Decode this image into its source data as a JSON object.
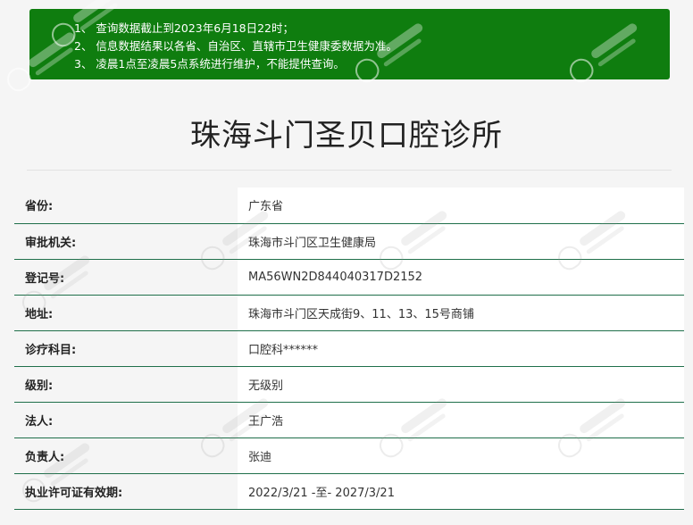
{
  "notice": {
    "lines": [
      "1、 查询数据截止到2023年6月18日22时；",
      "2、 信息数据结果以各省、自治区、直辖市卫生健康委数据为准。",
      "3、 凌晨1点至凌晨5点系统进行维护，不能提供查询。"
    ],
    "background_color": "#0f7d0f"
  },
  "title": "珠海斗门圣贝口腔诊所",
  "rows": [
    {
      "label": "省份:",
      "value": "广东省"
    },
    {
      "label": "审批机关:",
      "value": "珠海市斗门区卫生健康局"
    },
    {
      "label": "登记号:",
      "value": "MA56WN2D844040317D2152"
    },
    {
      "label": "地址:",
      "value": "珠海市斗门区天成街9、11、13、15号商铺"
    },
    {
      "label": "诊疗科目:",
      "value": "口腔科******"
    },
    {
      "label": "级别:",
      "value": "无级别"
    },
    {
      "label": "法人:",
      "value": "王广浩"
    },
    {
      "label": "负责人:",
      "value": "张迪"
    },
    {
      "label": "执业许可证有效期:",
      "value": "2022/3/21 -至- 2027/3/21"
    }
  ],
  "colors": {
    "row_divider": "#1f6f4a",
    "page_background": "#f5f5f5"
  }
}
